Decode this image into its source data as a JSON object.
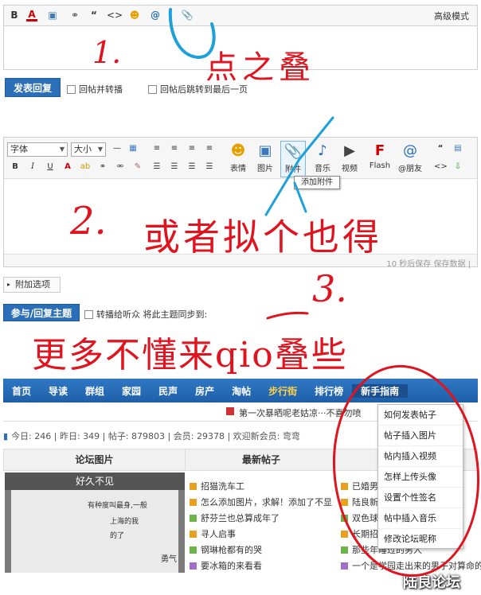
{
  "editor1": {
    "advanced_mode": "高级模式",
    "toolbar_glyphs": [
      "B",
      "A",
      "▣",
      "⚭",
      "“",
      "<>",
      "☻",
      "@",
      "📎"
    ]
  },
  "reply_bar": {
    "submit": "发表回复",
    "option1": "回帖并转播",
    "option2": "回帖后跳转到最后一页"
  },
  "editor2": {
    "font_select": "字体",
    "size_select": "大小",
    "big_buttons": [
      {
        "glyph": "☻",
        "label": "表情"
      },
      {
        "glyph": "▣",
        "label": "图片"
      },
      {
        "glyph": "📎",
        "label": "附件"
      },
      {
        "glyph": "♪",
        "label": "音乐"
      },
      {
        "glyph": "▶",
        "label": "视频"
      },
      {
        "glyph": "F",
        "label": "Flash"
      },
      {
        "glyph": "@",
        "label": "@朋友"
      }
    ],
    "tooltip": "添加附件",
    "status": "10 秒后保存 保存数据 |"
  },
  "attach_options": "附加选项",
  "topic_bar": {
    "submit": "参与/回复主题",
    "option": "转播给听众 将此主题同步到:"
  },
  "annotations": {
    "a1_num": "1.",
    "a1_text": "点之叠",
    "a2_num": "2.",
    "a2_text": "或者拟个也得",
    "a3_num": "3.",
    "a3_text": "更多不懂来qio叠些"
  },
  "forum": {
    "nav": [
      "首页",
      "导读",
      "群组",
      "家园",
      "民声",
      "房产",
      "淘帖",
      "步行街",
      "排行榜",
      "新手指南"
    ],
    "nav_highlight": "步行街",
    "sub_news": "第一次暴晒呢老姑凉···不喜勿喷",
    "stats": "今日: 246 | 昨日: 349 | 帖子: 879803 | 会员: 29378 | 欢迎新会员: 弯弯",
    "tabs": [
      "论坛图片",
      "最新帖子"
    ],
    "photo_caption": "好久不见",
    "photo_text_lines": [
      "有种度叫最身,一般",
      "上海的我",
      "的了",
      "勇气"
    ],
    "posts": [
      "招猫洗车工",
      "怎么添加图片，求解！添加了不显",
      "舒芬兰也总算成年了",
      "寻人启事",
      "钢琳枪都有的哭",
      "要冰箱的来看看"
    ],
    "posts_right": [
      "已婚男",
      "陆良新",
      "双色球",
      "长期招",
      "那些年睡过的男人",
      "一个是学园走出来的男子对算命的"
    ],
    "menu": [
      "如何发表帖子",
      "帖子插入图片",
      "帖内插入视频",
      "怎样上传头像",
      "设置个性签名",
      "帖中插入音乐",
      "修改论坛昵称"
    ],
    "watermark": "陆良论坛"
  },
  "colors": {
    "nav_blue": "#2b6fb8",
    "ink_red": "#e0141e",
    "ink_blue": "#1ea0d8"
  }
}
